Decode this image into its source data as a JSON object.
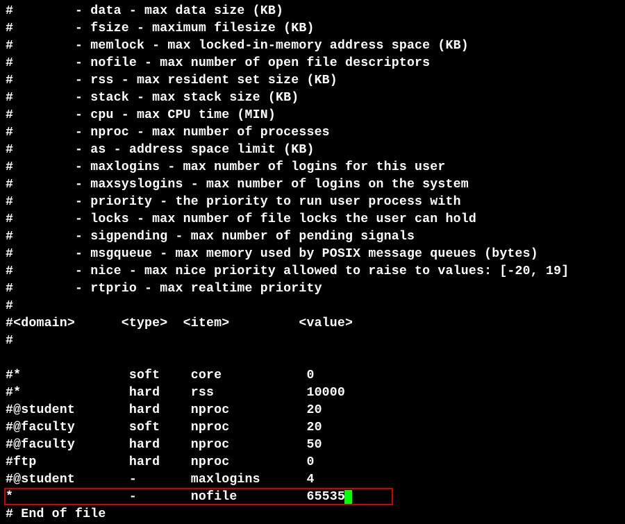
{
  "comment_descriptions": [
    "#        - data - max data size (KB)",
    "#        - fsize - maximum filesize (KB)",
    "#        - memlock - max locked-in-memory address space (KB)",
    "#        - nofile - max number of open file descriptors",
    "#        - rss - max resident set size (KB)",
    "#        - stack - max stack size (KB)",
    "#        - cpu - max CPU time (MIN)",
    "#        - nproc - max number of processes",
    "#        - as - address space limit (KB)",
    "#        - maxlogins - max number of logins for this user",
    "#        - maxsyslogins - max number of logins on the system",
    "#        - priority - the priority to run user process with",
    "#        - locks - max number of file locks the user can hold",
    "#        - sigpending - max number of pending signals",
    "#        - msgqueue - max memory used by POSIX message queues (bytes)",
    "#        - nice - max nice priority allowed to raise to values: [-20, 19]",
    "#        - rtprio - max realtime priority",
    "#"
  ],
  "header_line": "#<domain>      <type>  <item>         <value>",
  "post_header_blank": "#",
  "blank_line": "",
  "entries": [
    {
      "domain": "#*",
      "type": "soft",
      "item": "core",
      "value": "0"
    },
    {
      "domain": "#*",
      "type": "hard",
      "item": "rss",
      "value": "10000"
    },
    {
      "domain": "#@student",
      "type": "hard",
      "item": "nproc",
      "value": "20"
    },
    {
      "domain": "#@faculty",
      "type": "soft",
      "item": "nproc",
      "value": "20"
    },
    {
      "domain": "#@faculty",
      "type": "hard",
      "item": "nproc",
      "value": "50"
    },
    {
      "domain": "#ftp",
      "type": "hard",
      "item": "nproc",
      "value": "0"
    },
    {
      "domain": "#@student",
      "type": "-",
      "item": "maxlogins",
      "value": "4"
    },
    {
      "domain": "*",
      "type": "-",
      "item": "nofile",
      "value": "65535",
      "highlighted": true,
      "cursor": true
    }
  ],
  "footer": "# End of file",
  "columns": {
    "domain_width": 16,
    "type_width": 8,
    "item_width": 15
  }
}
